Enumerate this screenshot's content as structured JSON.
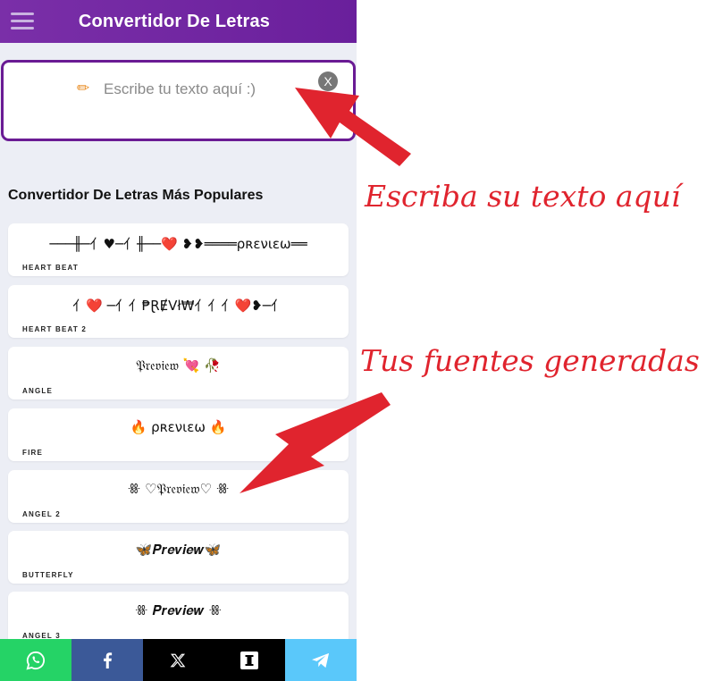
{
  "header": {
    "title": "Convertidor De Letras",
    "menu_icon": "hamburger-menu-icon"
  },
  "input": {
    "placeholder": "Escribe tu texto aquí :)",
    "value": "",
    "clear_label": "X",
    "pencil_icon": "pencil-icon"
  },
  "section": {
    "title": "Convertidor De Letras Más Populares"
  },
  "fonts": [
    {
      "name": "HEART BEAT",
      "preview": "───╫─⺅♥─⺅╫──❤️ ❥❥════ρʀɛνιɛω══"
    },
    {
      "name": "HEART BEAT 2",
      "preview": "⺅❤️ ─⺅⺅₱ⱤɆVł₩⺅⺅⺅❤️❥─⺅"
    },
    {
      "name": "ANGLE",
      "preview": "𝔓𝔯𝔢𝔳𝔦𝔢𝔴 💘 🥀"
    },
    {
      "name": "FIRE",
      "preview": "🔥 ρʀɛνιɛω 🔥"
    },
    {
      "name": "ANGEL 2",
      "preview": "ꗥ ♡𝔓𝔯𝔢𝔳𝔦𝔢𝔴♡ ꗥ"
    },
    {
      "name": "BUTTERFLY",
      "preview": "🦋𝑷𝒓𝒆𝒗𝒊𝒆𝒘🦋"
    },
    {
      "name": "ANGEL 3",
      "preview": "ꗥ 𝑷𝒓𝒆𝒗𝒊𝒆𝒘 ꗥ"
    }
  ],
  "share": [
    {
      "name": "whatsapp",
      "color": "#25d366",
      "icon": "whatsapp-icon"
    },
    {
      "name": "facebook",
      "color": "#3b5998",
      "icon": "facebook-icon"
    },
    {
      "name": "x",
      "color": "#000000",
      "icon": "x-icon"
    },
    {
      "name": "instapaper",
      "color": "#000000",
      "icon": "instapaper-icon"
    },
    {
      "name": "telegram",
      "color": "#5ac8fa",
      "icon": "telegram-icon"
    }
  ],
  "annotations": {
    "input_hint": "Escriba su texto aquí",
    "fonts_hint": "Tus fuentes generadas"
  },
  "colors": {
    "header": "#6a1f9c",
    "accent": "#6a1b94",
    "annotation": "#e0242e"
  }
}
